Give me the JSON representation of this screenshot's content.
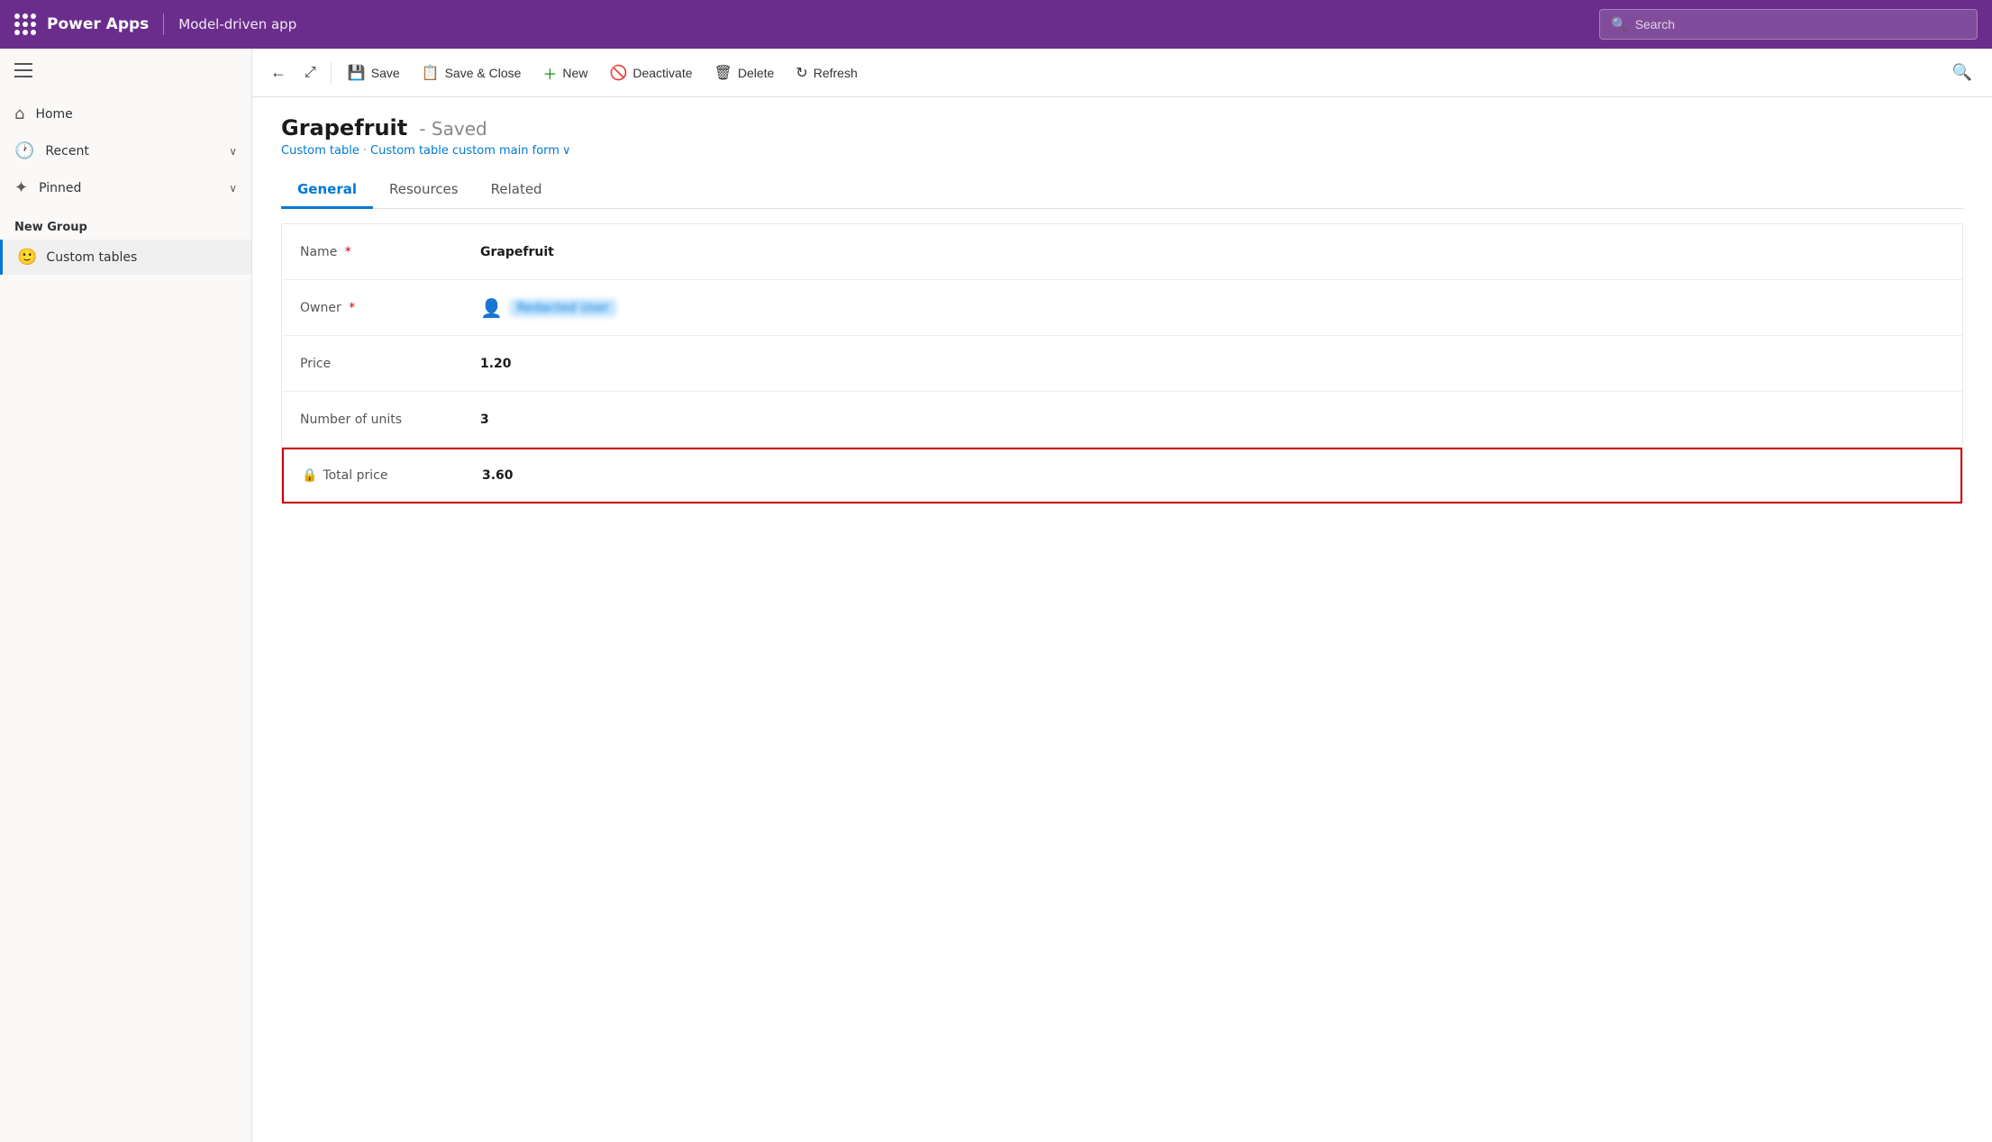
{
  "topBar": {
    "appName": "Power Apps",
    "modelName": "Model-driven app",
    "searchPlaceholder": "Search"
  },
  "sidebar": {
    "navItems": [
      {
        "id": "home",
        "label": "Home",
        "icon": "⌂"
      },
      {
        "id": "recent",
        "label": "Recent",
        "icon": "🕐",
        "hasChevron": true
      },
      {
        "id": "pinned",
        "label": "Pinned",
        "icon": "✦",
        "hasChevron": true
      }
    ],
    "sectionLabel": "New Group",
    "tableItem": {
      "label": "Custom tables",
      "emoji": "🙂"
    }
  },
  "commandBar": {
    "backTitle": "←",
    "expandTitle": "⤢",
    "saveLabel": "Save",
    "saveCloseLabel": "Save & Close",
    "newLabel": "New",
    "deactivateLabel": "Deactivate",
    "deleteLabel": "Delete",
    "refreshLabel": "Refresh"
  },
  "form": {
    "title": "Grapefruit",
    "savedStatus": "- Saved",
    "breadcrumb1": "Custom table",
    "breadcrumb2": "Custom table custom main form",
    "tabs": [
      "General",
      "Resources",
      "Related"
    ],
    "activeTab": "General",
    "fields": [
      {
        "id": "name",
        "label": "Name",
        "required": true,
        "value": "Grapefruit",
        "type": "text"
      },
      {
        "id": "owner",
        "label": "Owner",
        "required": true,
        "value": "owner-redacted",
        "type": "owner"
      },
      {
        "id": "price",
        "label": "Price",
        "required": false,
        "value": "1.20",
        "type": "text"
      },
      {
        "id": "units",
        "label": "Number of units",
        "required": false,
        "value": "3",
        "type": "text"
      },
      {
        "id": "total",
        "label": "Total price",
        "required": false,
        "value": "3.60",
        "type": "total"
      }
    ]
  }
}
